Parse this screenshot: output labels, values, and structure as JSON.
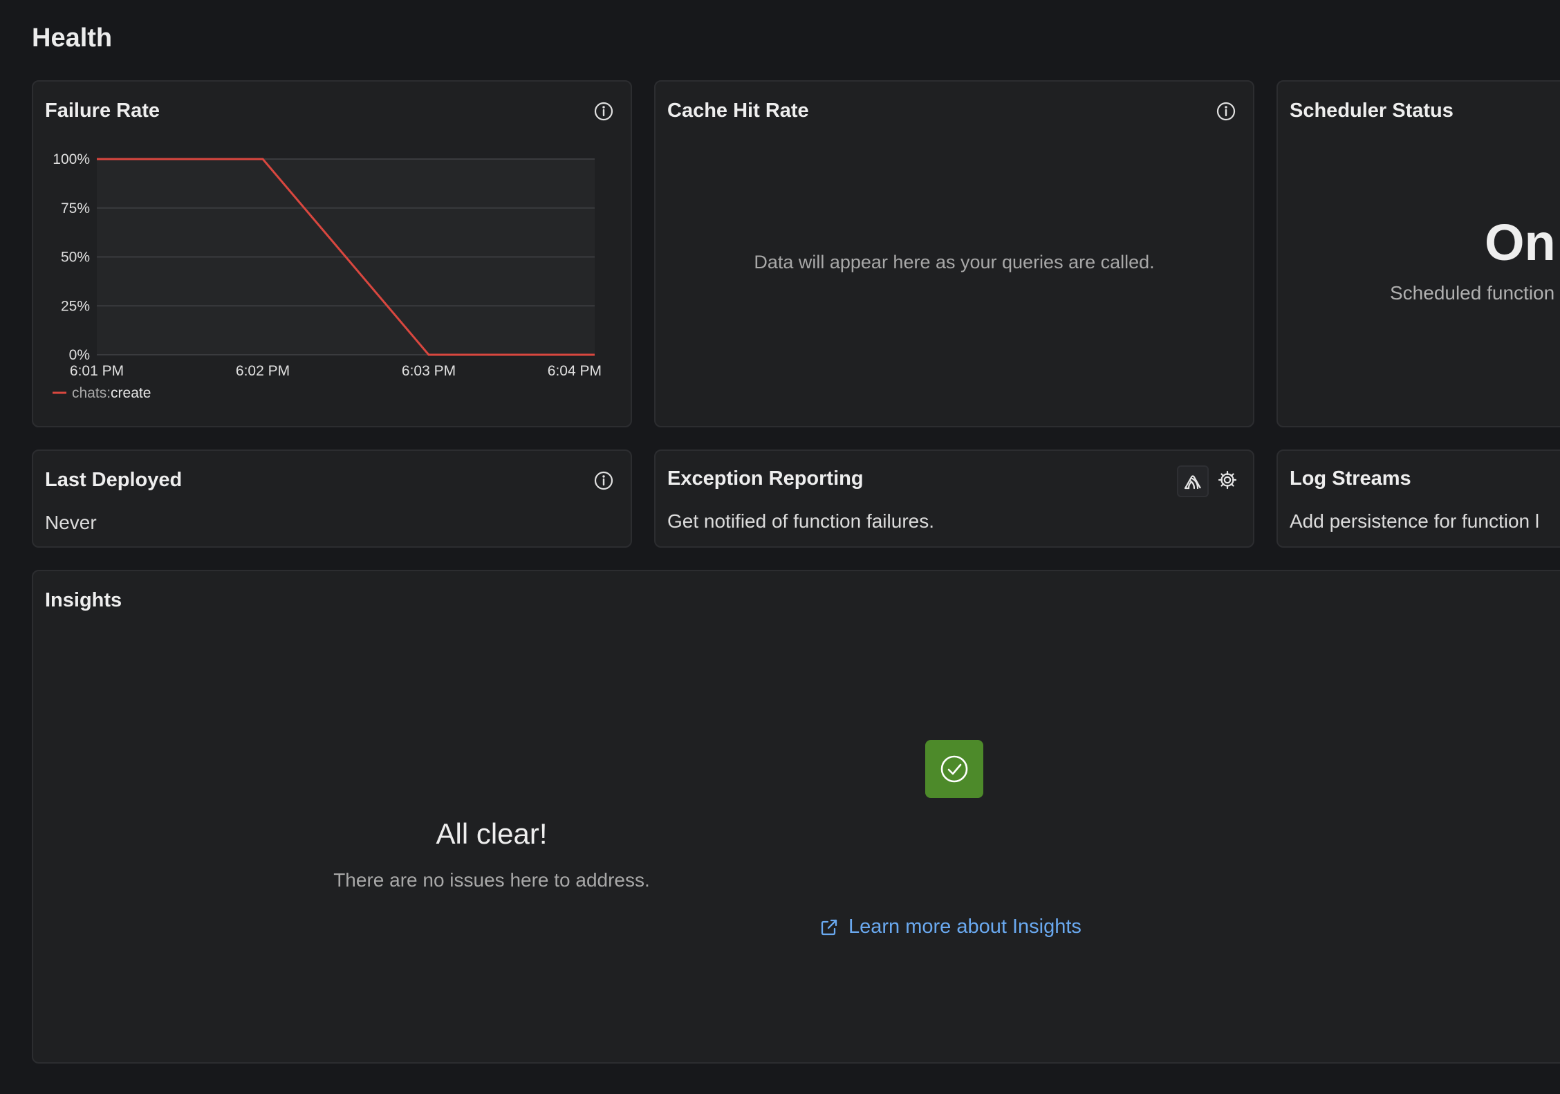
{
  "page": {
    "title": "Health"
  },
  "failure_rate": {
    "title": "Failure Rate",
    "icon": "info-icon",
    "line_color": "#d9473f"
  },
  "cache_hit_rate": {
    "title": "Cache Hit Rate",
    "icon": "info-icon",
    "empty_message": "Data will appear here as your queries are called."
  },
  "scheduler_status": {
    "title": "Scheduler Status",
    "status": "On",
    "description": "Scheduled function"
  },
  "last_deployed": {
    "title": "Last Deployed",
    "icon": "info-icon",
    "value": "Never"
  },
  "exception_reporting": {
    "title": "Exception Reporting",
    "icons": [
      "sentry-icon",
      "gear-icon"
    ],
    "description": "Get notified of function failures."
  },
  "log_streams": {
    "title": "Log Streams",
    "description": "Add persistence for function l"
  },
  "insights": {
    "title": "Insights",
    "status_icon": "check-circle-icon",
    "status_color": "#4d8a2a",
    "heading": "All clear!",
    "message": "There are no issues here to address.",
    "link_icon": "external-link-icon",
    "link_label": "Learn more about Insights",
    "link_color": "#6aa9f0"
  },
  "chart_data": {
    "type": "line",
    "title": "Failure Rate",
    "x": [
      "6:01 PM",
      "6:02 PM",
      "6:03 PM",
      "6:04 PM"
    ],
    "x_ticks": [
      "6:01 PM",
      "6:02 PM",
      "6:03 PM",
      "6:04 PM"
    ],
    "y_ticks": [
      "100%",
      "75%",
      "50%",
      "25%",
      "0%"
    ],
    "ylim": [
      0,
      100
    ],
    "grid": true,
    "legend_placement": "bottom-left",
    "series": [
      {
        "name": "chats:create",
        "color": "#d9473f",
        "points": [
          {
            "x": "6:01 PM",
            "y": 100
          },
          {
            "x": "6:02 PM",
            "y": 100
          },
          {
            "x": "6:03 PM",
            "y": 0
          },
          {
            "x": "6:04 PM",
            "y": 0
          }
        ]
      }
    ],
    "legend_prefix": "chats:",
    "legend_suffix": "create"
  }
}
